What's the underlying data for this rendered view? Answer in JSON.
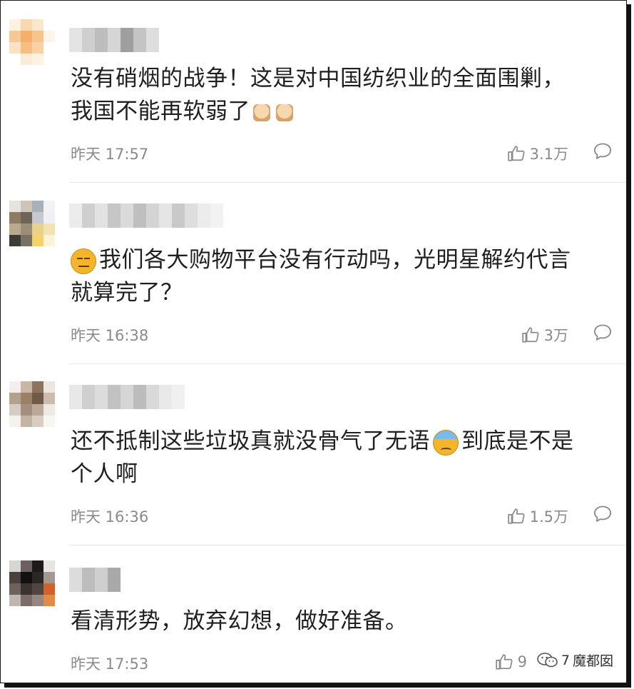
{
  "comments": [
    {
      "text": "没有硝烟的战争！这是对中国纺织业的全面围剿，",
      "text2": "我国不能再软弱了",
      "time": "昨天 17:57",
      "likes": "3.1万",
      "emojis": [
        "fist",
        "fist"
      ]
    },
    {
      "text": "我们各大购物平台没有行动吗，光明星解约代言",
      "text2": "就算完了？",
      "time": "昨天 16:38",
      "likes": "3万",
      "emojis": [
        "expressionless"
      ]
    },
    {
      "text_a": "还不抵制这些垃圾真就没骨气了无语",
      "text_b": "到底是不是",
      "text2": "个人啊",
      "time": "昨天 16:36",
      "likes": "1.5万",
      "emojis": [
        "sweat"
      ]
    },
    {
      "text": "看清形势，放弃幻想，做好准备。",
      "time": "昨天 17:53",
      "likes": "9",
      "likes_tail": "7"
    }
  ],
  "watermark": "魔都囡",
  "icons": {
    "like": "thumbs-up-icon",
    "reply": "speech-bubble-icon",
    "watermark": "wechat-icon"
  }
}
